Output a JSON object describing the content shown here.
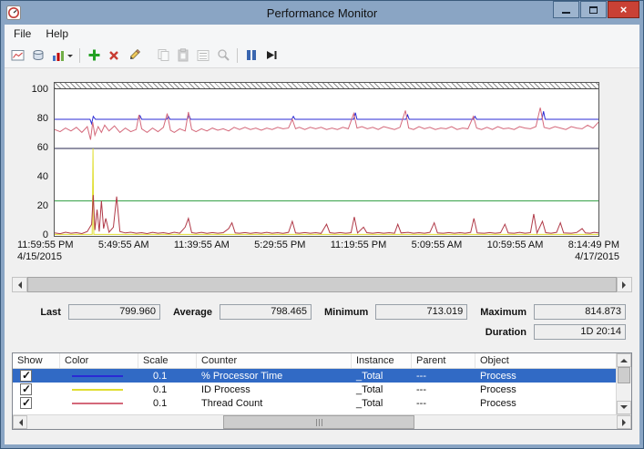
{
  "window": {
    "title": "Performance Monitor"
  },
  "menu": {
    "items": [
      "File",
      "Help"
    ]
  },
  "toolbar": {
    "buttons": [
      "view-current-activity",
      "view-log-data",
      "change-graph-type",
      "add-counter",
      "delete-counter",
      "highlight",
      "copy-properties",
      "paste-counter-list",
      "properties",
      "zoom",
      "freeze-display",
      "update-data"
    ]
  },
  "stats": {
    "items": [
      {
        "label": "Last",
        "value": "799.960"
      },
      {
        "label": "Average",
        "value": "798.465"
      },
      {
        "label": "Minimum",
        "value": "713.019"
      },
      {
        "label": "Maximum",
        "value": "814.873"
      }
    ],
    "duration": {
      "label": "Duration",
      "value": "1D 20:14"
    }
  },
  "table": {
    "columns": [
      "Show",
      "Color",
      "Scale",
      "Counter",
      "Instance",
      "Parent",
      "Object"
    ],
    "rows": [
      {
        "checked": true,
        "selected": true,
        "color": "#2a2ad4",
        "scale": "0.1",
        "counter": "% Processor Time",
        "instance": "_Total",
        "parent": "---",
        "object": "Process"
      },
      {
        "checked": true,
        "selected": false,
        "color": "#e0de30",
        "scale": "0.1",
        "counter": "ID Process",
        "instance": "_Total",
        "parent": "---",
        "object": "Process"
      },
      {
        "checked": true,
        "selected": false,
        "color": "#d4687a",
        "scale": "0.1",
        "counter": "Thread Count",
        "instance": "_Total",
        "parent": "---",
        "object": "Process"
      }
    ]
  },
  "chart_data": {
    "type": "line",
    "title": "",
    "ylim": [
      0,
      100
    ],
    "grid": false,
    "legend_position": "table-below",
    "y_ticks": [
      "100",
      "80",
      "60",
      "40",
      "20",
      "0"
    ],
    "time_labels": [
      {
        "line1": "11:59:55 PM",
        "line2": "4/15/2015"
      },
      {
        "line1": "5:49:55 AM"
      },
      {
        "line1": "11:39:55 AM"
      },
      {
        "line1": "5:29:55 PM"
      },
      {
        "line1": "11:19:55 PM"
      },
      {
        "line1": "5:09:55 AM"
      },
      {
        "line1": "10:59:55 AM"
      },
      {
        "line1": "8:14:49 PM",
        "line2": "4/17/2015"
      }
    ],
    "x_range": [
      "11:59:55 PM 4/15/2015",
      "8:14:49 PM 4/17/2015"
    ],
    "series": [
      {
        "name": "unlisted-dark-flat",
        "color": "#26264f",
        "points": [
          [
            0,
            60
          ],
          [
            100,
            60
          ]
        ]
      },
      {
        "name": "unlisted-green-flat",
        "color": "#2e9e40",
        "points": [
          [
            0,
            24
          ],
          [
            100,
            24
          ]
        ]
      },
      {
        "name": "ID Process (_Total, scale 0.1)",
        "color": "#e0de30",
        "points": [
          [
            0,
            1
          ],
          [
            6.9,
            1
          ],
          [
            7.05,
            60
          ],
          [
            7.2,
            1
          ],
          [
            100,
            1
          ]
        ]
      },
      {
        "name": "% Processor Time (_Total, scale 0.1)",
        "color": "#2a2ad4",
        "points": [
          [
            0,
            80
          ],
          [
            6.5,
            80
          ],
          [
            6.8,
            77
          ],
          [
            7.1,
            82
          ],
          [
            7.5,
            80
          ],
          [
            15.4,
            80
          ],
          [
            15.7,
            82.5
          ],
          [
            16,
            80
          ],
          [
            20.6,
            80
          ],
          [
            20.9,
            82
          ],
          [
            21.2,
            80
          ],
          [
            24.4,
            80
          ],
          [
            24.7,
            83
          ],
          [
            25,
            80
          ],
          [
            43.6,
            80
          ],
          [
            43.9,
            82
          ],
          [
            44.2,
            80
          ],
          [
            55,
            80
          ],
          [
            55.3,
            84.5
          ],
          [
            55.6,
            80
          ],
          [
            64.6,
            80
          ],
          [
            64.9,
            83
          ],
          [
            65.2,
            80
          ],
          [
            77,
            80
          ],
          [
            77.3,
            82
          ],
          [
            77.6,
            80
          ],
          [
            89.6,
            80
          ],
          [
            89.9,
            85.5
          ],
          [
            90.2,
            80
          ],
          [
            100,
            80
          ]
        ]
      },
      {
        "name": "Thread Count (_Total, scale 0.1)",
        "color": "#d4687a",
        "points": [
          [
            0,
            73
          ],
          [
            1,
            71.5
          ],
          [
            2,
            74
          ],
          [
            3,
            72
          ],
          [
            4,
            74.5
          ],
          [
            5,
            71
          ],
          [
            6,
            75
          ],
          [
            6.6,
            66
          ],
          [
            7,
            78
          ],
          [
            7.4,
            69
          ],
          [
            8,
            75
          ],
          [
            8.6,
            71
          ],
          [
            9.2,
            76
          ],
          [
            10,
            72
          ],
          [
            11,
            75.5
          ],
          [
            12,
            71
          ],
          [
            13,
            74
          ],
          [
            14,
            71.5
          ],
          [
            15,
            73
          ],
          [
            15.5,
            83
          ],
          [
            16,
            73.5
          ],
          [
            17,
            71
          ],
          [
            18,
            74
          ],
          [
            19,
            71.5
          ],
          [
            20,
            74.5
          ],
          [
            20.7,
            84
          ],
          [
            21.3,
            72.5
          ],
          [
            22,
            71
          ],
          [
            23,
            73.5
          ],
          [
            24,
            72
          ],
          [
            24.6,
            85
          ],
          [
            25.2,
            73
          ],
          [
            26,
            71.5
          ],
          [
            27,
            73.5
          ],
          [
            28,
            72
          ],
          [
            29,
            74
          ],
          [
            30,
            72.5
          ],
          [
            31,
            73.5
          ],
          [
            32,
            72
          ],
          [
            33,
            74.5
          ],
          [
            34,
            73
          ],
          [
            35,
            74.5
          ],
          [
            36,
            73
          ],
          [
            37,
            74
          ],
          [
            38,
            72.5
          ],
          [
            39,
            74
          ],
          [
            40,
            73
          ],
          [
            41,
            74.5
          ],
          [
            42,
            73.5
          ],
          [
            43,
            74
          ],
          [
            43.7,
            80
          ],
          [
            44.3,
            73.5
          ],
          [
            45,
            74.5
          ],
          [
            46,
            73
          ],
          [
            47,
            74.5
          ],
          [
            48,
            73.5
          ],
          [
            49,
            74.5
          ],
          [
            50,
            73
          ],
          [
            51,
            74
          ],
          [
            52,
            73
          ],
          [
            53,
            74.5
          ],
          [
            54,
            73.5
          ],
          [
            55,
            84
          ],
          [
            55.6,
            74
          ],
          [
            56.5,
            75
          ],
          [
            57.5,
            73.5
          ],
          [
            58.5,
            74.5
          ],
          [
            59.5,
            73
          ],
          [
            60.5,
            75
          ],
          [
            61.5,
            74
          ],
          [
            62.5,
            73
          ],
          [
            63.5,
            74.5
          ],
          [
            64.5,
            86
          ],
          [
            65.1,
            74
          ],
          [
            66,
            73
          ],
          [
            67,
            75
          ],
          [
            68,
            73.5
          ],
          [
            69,
            74.5
          ],
          [
            70,
            73
          ],
          [
            71,
            74
          ],
          [
            72,
            73.5
          ],
          [
            73,
            75
          ],
          [
            74,
            73
          ],
          [
            75,
            74
          ],
          [
            76,
            73.5
          ],
          [
            77,
            82
          ],
          [
            77.6,
            74
          ],
          [
            78.5,
            73
          ],
          [
            79.5,
            74.5
          ],
          [
            80.5,
            73
          ],
          [
            81.5,
            75
          ],
          [
            82.5,
            73.5
          ],
          [
            83.5,
            74
          ],
          [
            84.5,
            73
          ],
          [
            85.5,
            75
          ],
          [
            86.5,
            74
          ],
          [
            87.5,
            73.5
          ],
          [
            88.5,
            75
          ],
          [
            89.3,
            88
          ],
          [
            90,
            74.5
          ],
          [
            91,
            73.5
          ],
          [
            92,
            75
          ],
          [
            93,
            74
          ],
          [
            94,
            73
          ],
          [
            95,
            75
          ],
          [
            96,
            74
          ],
          [
            97,
            73.5
          ],
          [
            98,
            76
          ],
          [
            99,
            74
          ],
          [
            100,
            78
          ]
        ]
      },
      {
        "name": "unlisted-maroon-spiky",
        "color": "#b03a48",
        "points": [
          [
            0,
            2
          ],
          [
            1,
            1.5
          ],
          [
            2,
            2.5
          ],
          [
            3,
            1.8
          ],
          [
            4,
            2.2
          ],
          [
            5,
            1.6
          ],
          [
            6,
            3
          ],
          [
            6.8,
            8
          ],
          [
            7.1,
            28
          ],
          [
            7.4,
            4
          ],
          [
            7.8,
            18
          ],
          [
            8.2,
            3
          ],
          [
            8.6,
            24
          ],
          [
            9,
            5
          ],
          [
            9.4,
            12
          ],
          [
            10,
            2.5
          ],
          [
            10.8,
            6
          ],
          [
            11.4,
            27
          ],
          [
            12,
            3
          ],
          [
            13,
            2
          ],
          [
            14,
            2.5
          ],
          [
            15,
            1.8
          ],
          [
            16,
            2.2
          ],
          [
            17,
            1.6
          ],
          [
            18,
            2.4
          ],
          [
            19,
            1.8
          ],
          [
            20,
            2.2
          ],
          [
            21,
            1.6
          ],
          [
            22,
            2.5
          ],
          [
            23,
            1.8
          ],
          [
            24,
            6
          ],
          [
            24.6,
            12
          ],
          [
            25.2,
            2.2
          ],
          [
            26,
            1.8
          ],
          [
            27,
            2.4
          ],
          [
            28,
            1.7
          ],
          [
            29,
            2.3
          ],
          [
            30,
            1.8
          ],
          [
            31,
            2.2
          ],
          [
            32,
            5
          ],
          [
            32.6,
            9
          ],
          [
            33.2,
            2
          ],
          [
            34,
            1.8
          ],
          [
            35,
            2.3
          ],
          [
            36,
            1.7
          ],
          [
            37,
            2.2
          ],
          [
            38,
            1.8
          ],
          [
            39,
            2.4
          ],
          [
            40,
            1.8
          ],
          [
            41,
            2.2
          ],
          [
            42,
            1.7
          ],
          [
            43,
            2.4
          ],
          [
            43.7,
            10
          ],
          [
            44.3,
            2
          ],
          [
            45,
            1.8
          ],
          [
            46,
            2.3
          ],
          [
            47,
            1.8
          ],
          [
            48,
            2.2
          ],
          [
            49,
            1.7
          ],
          [
            50,
            8
          ],
          [
            50.6,
            2.2
          ],
          [
            51.5,
            1.8
          ],
          [
            52.5,
            2.3
          ],
          [
            53.5,
            1.8
          ],
          [
            54.5,
            2.2
          ],
          [
            55.1,
            13
          ],
          [
            55.7,
            2
          ],
          [
            56.8,
            6
          ],
          [
            57.4,
            2.2
          ],
          [
            58.5,
            1.8
          ],
          [
            59.5,
            2.3
          ],
          [
            60.5,
            1.8
          ],
          [
            61.5,
            2.2
          ],
          [
            62.5,
            1.8
          ],
          [
            63.1,
            8
          ],
          [
            63.7,
            2
          ],
          [
            65,
            2.4
          ],
          [
            66,
            1.8
          ],
          [
            67,
            2.2
          ],
          [
            68,
            1.8
          ],
          [
            69,
            2.4
          ],
          [
            69.8,
            9
          ],
          [
            70.4,
            2
          ],
          [
            71.5,
            1.8
          ],
          [
            72.5,
            2.3
          ],
          [
            73.5,
            1.8
          ],
          [
            74.5,
            2.2
          ],
          [
            75.5,
            1.8
          ],
          [
            76.5,
            2.4
          ],
          [
            77.1,
            12
          ],
          [
            77.7,
            2
          ],
          [
            79,
            1.8
          ],
          [
            80,
            2.3
          ],
          [
            81,
            1.8
          ],
          [
            82,
            2.2
          ],
          [
            82.8,
            8
          ],
          [
            83.4,
            2
          ],
          [
            84.5,
            1.8
          ],
          [
            85.5,
            2.4
          ],
          [
            86.5,
            1.8
          ],
          [
            87.5,
            2.2
          ],
          [
            88.1,
            15
          ],
          [
            88.7,
            2
          ],
          [
            89.7,
            10
          ],
          [
            90.3,
            2.2
          ],
          [
            91.3,
            1.8
          ],
          [
            92.3,
            2.4
          ],
          [
            93,
            9
          ],
          [
            93.6,
            2
          ],
          [
            95,
            1.8
          ],
          [
            96,
            2.3
          ],
          [
            97,
            5
          ],
          [
            97.6,
            2
          ],
          [
            98.5,
            1.8
          ],
          [
            99.2,
            2.4
          ],
          [
            100,
            2
          ]
        ]
      }
    ]
  }
}
